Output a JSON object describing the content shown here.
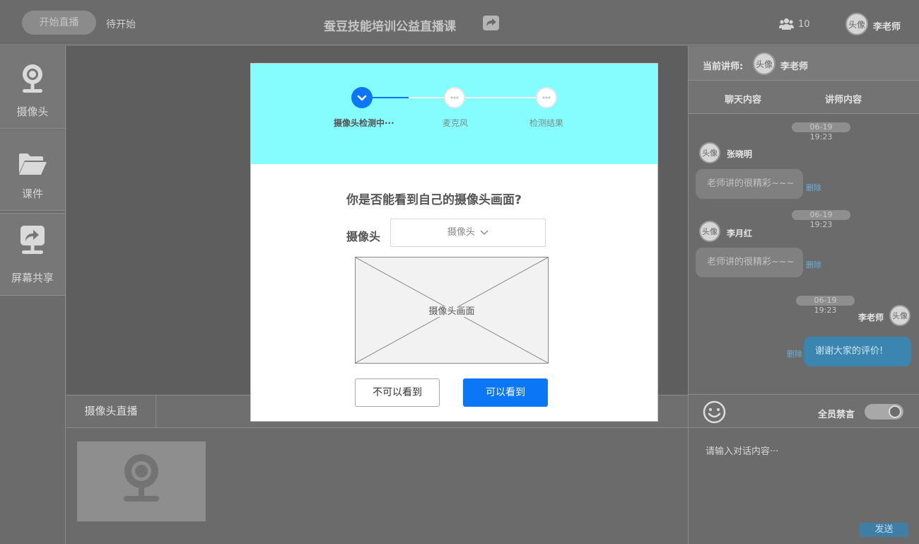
{
  "topbar": {
    "start_button": "开始直播",
    "status": "待开始",
    "course_title": "蚕豆技能培训公益直播课",
    "online_count": "10",
    "avatar_text": "头像",
    "teacher_name": "李老师"
  },
  "sidebar": {
    "items": [
      {
        "label": "摄像头",
        "icon": "webcam-icon"
      },
      {
        "label": "课件",
        "icon": "folder-open-icon"
      },
      {
        "label": "屏幕共享",
        "icon": "screen-share-icon"
      }
    ]
  },
  "bottom": {
    "tab_label": "摄像头直播"
  },
  "right": {
    "lecturer_label": "当前讲师:",
    "lecturer_avatar": "头像",
    "lecturer_name": "李老师",
    "tabs": [
      "聊天内容",
      "讲师内容"
    ],
    "messages": [
      {
        "time": "06-19 19:23",
        "avatar": "头像",
        "name": "张晓明",
        "text": "老师讲的很精彩~~~",
        "delete": "删除",
        "mine": false
      },
      {
        "time": "06-19 19:23",
        "avatar": "头像",
        "name": "李月红",
        "text": "老师讲的很精彩~~~",
        "delete": "删除",
        "mine": false
      },
      {
        "time": "06-19 19:23",
        "avatar": "头像",
        "name": "李老师",
        "text": "谢谢大家的评价!",
        "delete": "删除",
        "mine": true
      }
    ],
    "mute_all_label": "全员禁言",
    "mute_all_on": true,
    "input_placeholder": "请输入对话内容···",
    "send_label": "发送"
  },
  "modal": {
    "steps": [
      {
        "label": "摄像头检测中···",
        "state": "active"
      },
      {
        "label": "麦克风",
        "state": "pending"
      },
      {
        "label": "检测结果",
        "state": "pending"
      }
    ],
    "question": "你是否能看到自己的摄像头画面?",
    "camera_label": "摄像头",
    "camera_selected": "摄像头",
    "preview_text": "摄像头画面",
    "no_button": "不可以看到",
    "yes_button": "可以看到"
  },
  "colors": {
    "accent_blue": "#0b76f6",
    "modal_header": "#85fdfe",
    "send_button": "#3f7fa6"
  }
}
